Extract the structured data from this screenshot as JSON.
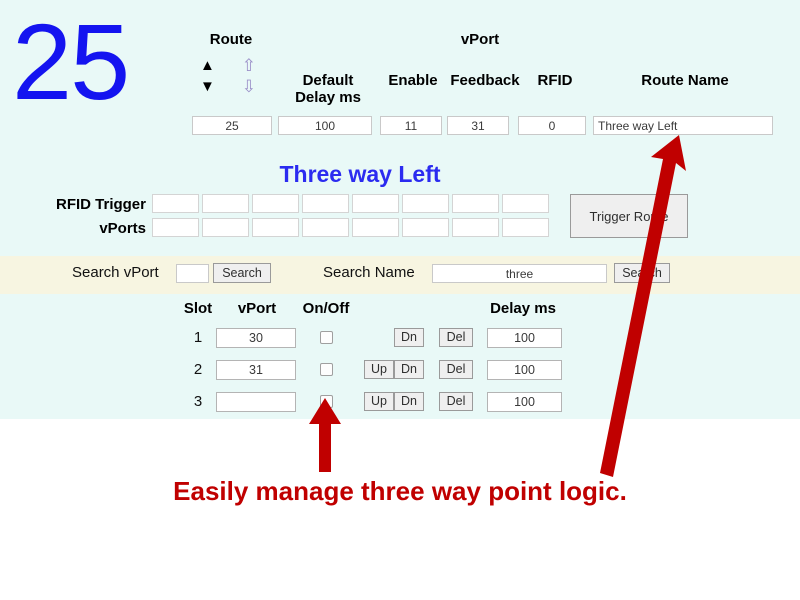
{
  "app": {
    "route_number": "25",
    "header": {
      "route_label": "Route",
      "vport_group_label": "vPort",
      "default_delay_label": "Default\nDelay ms",
      "default_label": "Default",
      "delay_ms_label": "Delay ms",
      "enable_label": "Enable",
      "feedback_label": "Feedback",
      "rfid_label": "RFID",
      "route_name_label": "Route Name",
      "arrow_up_solid": "▲",
      "arrow_up_hollow": "⇧",
      "arrow_down_solid": "▼",
      "arrow_down_hollow": "⇩"
    },
    "fields": {
      "route": "25",
      "default_delay": "100",
      "enable": "11",
      "feedback": "31",
      "rfid": "0",
      "route_name": "Three way Left"
    },
    "route_title": "Three way Left",
    "trigger_section": {
      "rfid_trigger_label": "RFID Trigger",
      "vports_label": "vPorts",
      "rfid_trigger_values": [
        "",
        "",
        "",
        "",
        "",
        "",
        "",
        ""
      ],
      "vports_values": [
        "",
        "",
        "",
        "",
        "",
        "",
        "",
        ""
      ],
      "trigger_route_button": "Trigger Route"
    },
    "search": {
      "search_vport_label": "Search vPort",
      "search_vport_value": "",
      "search_vport_button": "Search",
      "search_name_label": "Search Name",
      "search_name_value": "three",
      "search_name_button": "Search"
    },
    "slot_table": {
      "columns": {
        "slot": "Slot",
        "vport": "vPort",
        "onoff": "On/Off",
        "delay": "Delay ms"
      },
      "buttons": {
        "up": "Up",
        "dn": "Dn",
        "del": "Del"
      },
      "rows": [
        {
          "slot": "1",
          "vport": "30",
          "checked": false,
          "has_up": false,
          "has_dn": true,
          "has_del": true,
          "delay": "100"
        },
        {
          "slot": "2",
          "vport": "31",
          "checked": false,
          "has_up": true,
          "has_dn": true,
          "has_del": true,
          "delay": "100"
        },
        {
          "slot": "3",
          "vport": "",
          "checked": false,
          "has_up": true,
          "has_dn": true,
          "has_del": true,
          "delay": "100"
        }
      ]
    }
  },
  "annotation": {
    "caption": "Easily manage three way point logic.",
    "caption_color": "#c00000",
    "arrow_color": "#c00000"
  },
  "colors": {
    "app_background": "#e9f9f7",
    "search_band": "#f7f5e1",
    "route_number": "#1414f0",
    "route_title": "#2b2bf0",
    "page_background": "#ffffff"
  }
}
